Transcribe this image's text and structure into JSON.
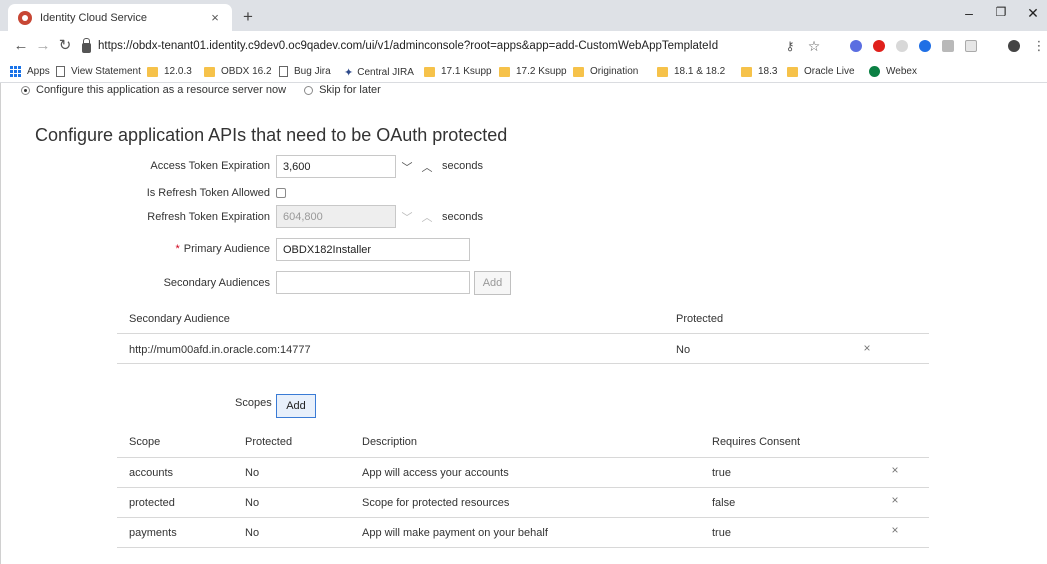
{
  "browser": {
    "tab_title": "Identity Cloud Service",
    "tab_close": "×",
    "new_tab": "+",
    "url": "https://obdx-tenant01.identity.c9dev0.oc9qadev.com/ui/v1/adminconsole?root=apps&app=add-CustomWebAppTemplateId",
    "bookmarks": [
      {
        "label": "Apps",
        "kind": "apps"
      },
      {
        "label": "View Statement",
        "kind": "page"
      },
      {
        "label": "12.0.3",
        "kind": "folder"
      },
      {
        "label": "OBDX 16.2",
        "kind": "folder"
      },
      {
        "label": "Bug Jira",
        "kind": "page"
      },
      {
        "label": "Central JIRA",
        "kind": "jira"
      },
      {
        "label": "17.1 Ksupp",
        "kind": "folder"
      },
      {
        "label": "17.2 Ksupp",
        "kind": "folder"
      },
      {
        "label": "Origination",
        "kind": "folder"
      },
      {
        "label": "18.1 & 18.2",
        "kind": "folder"
      },
      {
        "label": "18.3",
        "kind": "folder"
      },
      {
        "label": "Oracle Live",
        "kind": "folder"
      },
      {
        "label": "Webex",
        "kind": "globe"
      }
    ]
  },
  "resource_server": {
    "option_now": "Configure this application as a resource server now",
    "option_later": "Skip for later",
    "selected": "now"
  },
  "heading": "Configure application APIs that need to be OAuth protected",
  "form": {
    "access_token_label": "Access Token Expiration",
    "access_token_value": "3,600",
    "seconds": "seconds",
    "refresh_allowed_label": "Is Refresh Token Allowed",
    "refresh_allowed_checked": false,
    "refresh_expiration_label": "Refresh Token Expiration",
    "refresh_expiration_value": "604,800",
    "required_marker": "*",
    "primary_audience_label": "Primary Audience",
    "primary_audience_value": "OBDX182Installer",
    "secondary_audiences_label": "Secondary Audiences",
    "secondary_audiences_value": "",
    "add_label": "Add"
  },
  "secondary_table": {
    "headers": [
      "Secondary Audience",
      "Protected"
    ],
    "rows": [
      {
        "audience": "http://mum00afd.in.oracle.com:14777",
        "protected": "No"
      }
    ]
  },
  "scopes": {
    "label": "Scopes",
    "add_label": "Add",
    "headers": [
      "Scope",
      "Protected",
      "Description",
      "Requires Consent"
    ],
    "rows": [
      {
        "scope": "accounts",
        "protected": "No",
        "description": "App will access your accounts",
        "consent": "true"
      },
      {
        "scope": "protected",
        "protected": "No",
        "description": "Scope for protected resources",
        "consent": "false"
      },
      {
        "scope": "payments",
        "protected": "No",
        "description": "App will make payment on your behalf",
        "consent": "true"
      }
    ]
  },
  "delete_glyph": "×"
}
